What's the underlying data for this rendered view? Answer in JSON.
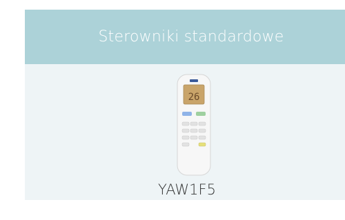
{
  "card": {
    "title": "Sterowniki standardowe",
    "product": {
      "name": "YAW1F5",
      "image_icon": "remote-control-icon",
      "display_text": "26"
    }
  },
  "colors": {
    "header_bg": "#acd2d8",
    "card_bg": "#eef4f6",
    "title_text": "#ffffff",
    "product_text": "#333333"
  }
}
